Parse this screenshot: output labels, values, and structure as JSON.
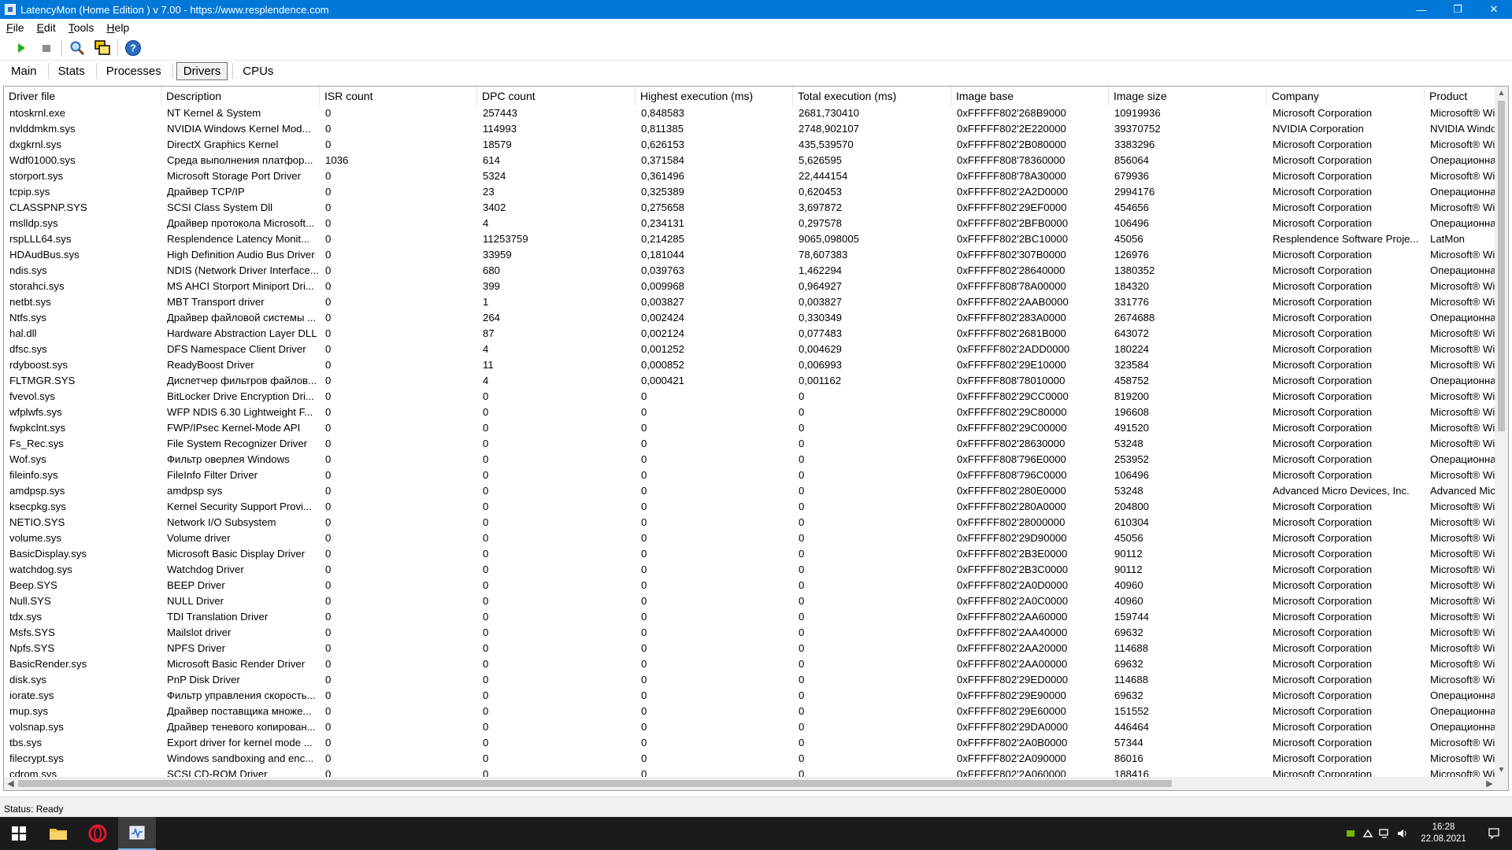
{
  "window": {
    "title": "LatencyMon  (Home Edition )  v 7.00 - https://www.resplendence.com",
    "minimize": "—",
    "maximize": "❐",
    "close": "✕"
  },
  "menu": [
    "File",
    "Edit",
    "Tools",
    "Help"
  ],
  "toolbar": {
    "icons": [
      "play-icon",
      "stop-icon",
      "search-icon",
      "windows-icon",
      "help-icon"
    ]
  },
  "tabs": [
    "Main",
    "Stats",
    "Processes",
    "Drivers",
    "CPUs"
  ],
  "active_tab": "Drivers",
  "table": {
    "headers": [
      "Driver file",
      "Description",
      "ISR count",
      "DPC count",
      "Highest execution (ms)",
      "Total execution (ms)",
      "Image base",
      "Image size",
      "Company",
      "Product"
    ],
    "rows": [
      [
        "ntoskrnl.exe",
        "NT Kernel & System",
        "0",
        "257443",
        "0,848583",
        "2681,730410",
        "0xFFFFF802'268B9000",
        "10919936",
        "Microsoft Corporation",
        "Microsoft® Wi"
      ],
      [
        "nvlddmkm.sys",
        "NVIDIA Windows Kernel Mod...",
        "0",
        "114993",
        "0,811385",
        "2748,902107",
        "0xFFFFF802'2E220000",
        "39370752",
        "NVIDIA Corporation",
        "NVIDIA Windo"
      ],
      [
        "dxgkrnl.sys",
        "DirectX Graphics Kernel",
        "0",
        "18579",
        "0,626153",
        "435,539570",
        "0xFFFFF802'2B080000",
        "3383296",
        "Microsoft Corporation",
        "Microsoft® Wi"
      ],
      [
        "Wdf01000.sys",
        "Среда выполнения платфор...",
        "1036",
        "614",
        "0,371584",
        "5,626595",
        "0xFFFFF808'78360000",
        "856064",
        "Microsoft Corporation",
        "Операционная"
      ],
      [
        "storport.sys",
        "Microsoft Storage Port Driver",
        "0",
        "5324",
        "0,361496",
        "22,444154",
        "0xFFFFF808'78A30000",
        "679936",
        "Microsoft Corporation",
        "Microsoft® Wi"
      ],
      [
        "tcpip.sys",
        "Драйвер TCP/IP",
        "0",
        "23",
        "0,325389",
        "0,620453",
        "0xFFFFF802'2A2D0000",
        "2994176",
        "Microsoft Corporation",
        "Операционная"
      ],
      [
        "CLASSPNP.SYS",
        "SCSI Class System Dll",
        "0",
        "3402",
        "0,275658",
        "3,697872",
        "0xFFFFF802'29EF0000",
        "454656",
        "Microsoft Corporation",
        "Microsoft® Wi"
      ],
      [
        "mslldp.sys",
        "Драйвер протокола Microsoft...",
        "0",
        "4",
        "0,234131",
        "0,297578",
        "0xFFFFF802'2BFB0000",
        "106496",
        "Microsoft Corporation",
        "Операционная"
      ],
      [
        "rspLLL64.sys",
        "Resplendence Latency Monit...",
        "0",
        "11253759",
        "0,214285",
        "9065,098005",
        "0xFFFFF802'2BC10000",
        "45056",
        "Resplendence Software Proje...",
        "LatMon"
      ],
      [
        "HDAudBus.sys",
        "High Definition Audio Bus Driver",
        "0",
        "33959",
        "0,181044",
        "78,607383",
        "0xFFFFF802'307B0000",
        "126976",
        "Microsoft Corporation",
        "Microsoft® Wi"
      ],
      [
        "ndis.sys",
        "NDIS (Network Driver Interface...",
        "0",
        "680",
        "0,039763",
        "1,462294",
        "0xFFFFF802'28640000",
        "1380352",
        "Microsoft Corporation",
        "Операционная"
      ],
      [
        "storahci.sys",
        "MS AHCI Storport Miniport Dri...",
        "0",
        "399",
        "0,009968",
        "0,964927",
        "0xFFFFF808'78A00000",
        "184320",
        "Microsoft Corporation",
        "Microsoft® Wi"
      ],
      [
        "netbt.sys",
        "MBT Transport driver",
        "0",
        "1",
        "0,003827",
        "0,003827",
        "0xFFFFF802'2AAB0000",
        "331776",
        "Microsoft Corporation",
        "Microsoft® Wi"
      ],
      [
        "Ntfs.sys",
        "Драйвер файловой системы ...",
        "0",
        "264",
        "0,002424",
        "0,330349",
        "0xFFFFF802'283A0000",
        "2674688",
        "Microsoft Corporation",
        "Операционная"
      ],
      [
        "hal.dll",
        "Hardware Abstraction Layer DLL",
        "0",
        "87",
        "0,002124",
        "0,077483",
        "0xFFFFF802'2681B000",
        "643072",
        "Microsoft Corporation",
        "Microsoft® Wi"
      ],
      [
        "dfsc.sys",
        "DFS Namespace Client Driver",
        "0",
        "4",
        "0,001252",
        "0,004629",
        "0xFFFFF802'2ADD0000",
        "180224",
        "Microsoft Corporation",
        "Microsoft® Wi"
      ],
      [
        "rdyboost.sys",
        "ReadyBoost Driver",
        "0",
        "11",
        "0,000852",
        "0,006993",
        "0xFFFFF802'29E10000",
        "323584",
        "Microsoft Corporation",
        "Microsoft® Wi"
      ],
      [
        "FLTMGR.SYS",
        "Диспетчер фильтров файлов...",
        "0",
        "4",
        "0,000421",
        "0,001162",
        "0xFFFFF808'78010000",
        "458752",
        "Microsoft Corporation",
        "Операционная"
      ],
      [
        "fvevol.sys",
        "BitLocker Drive Encryption Dri...",
        "0",
        "0",
        "0",
        "0",
        "0xFFFFF802'29CC0000",
        "819200",
        "Microsoft Corporation",
        "Microsoft® Wi"
      ],
      [
        "wfplwfs.sys",
        "WFP NDIS 6.30 Lightweight F...",
        "0",
        "0",
        "0",
        "0",
        "0xFFFFF802'29C80000",
        "196608",
        "Microsoft Corporation",
        "Microsoft® Wi"
      ],
      [
        "fwpkclnt.sys",
        "FWP/IPsec Kernel-Mode API",
        "0",
        "0",
        "0",
        "0",
        "0xFFFFF802'29C00000",
        "491520",
        "Microsoft Corporation",
        "Microsoft® Wi"
      ],
      [
        "Fs_Rec.sys",
        "File System Recognizer Driver",
        "0",
        "0",
        "0",
        "0",
        "0xFFFFF802'28630000",
        "53248",
        "Microsoft Corporation",
        "Microsoft® Wi"
      ],
      [
        "Wof.sys",
        "Фильтр оверлея Windows",
        "0",
        "0",
        "0",
        "0",
        "0xFFFFF808'796E0000",
        "253952",
        "Microsoft Corporation",
        "Операционная"
      ],
      [
        "fileinfo.sys",
        "FileInfo Filter Driver",
        "0",
        "0",
        "0",
        "0",
        "0xFFFFF808'796C0000",
        "106496",
        "Microsoft Corporation",
        "Microsoft® Wi"
      ],
      [
        "amdpsp.sys",
        "amdpsp sys",
        "0",
        "0",
        "0",
        "0",
        "0xFFFFF802'280E0000",
        "53248",
        "Advanced Micro Devices, Inc.",
        "Advanced Micr"
      ],
      [
        "ksecpkg.sys",
        "Kernel Security Support Provi...",
        "0",
        "0",
        "0",
        "0",
        "0xFFFFF802'280A0000",
        "204800",
        "Microsoft Corporation",
        "Microsoft® Wi"
      ],
      [
        "NETIO.SYS",
        "Network I/O Subsystem",
        "0",
        "0",
        "0",
        "0",
        "0xFFFFF802'28000000",
        "610304",
        "Microsoft Corporation",
        "Microsoft® Wi"
      ],
      [
        "volume.sys",
        "Volume driver",
        "0",
        "0",
        "0",
        "0",
        "0xFFFFF802'29D90000",
        "45056",
        "Microsoft Corporation",
        "Microsoft® Wi"
      ],
      [
        "BasicDisplay.sys",
        "Microsoft Basic Display Driver",
        "0",
        "0",
        "0",
        "0",
        "0xFFFFF802'2B3E0000",
        "90112",
        "Microsoft Corporation",
        "Microsoft® Wi"
      ],
      [
        "watchdog.sys",
        "Watchdog Driver",
        "0",
        "0",
        "0",
        "0",
        "0xFFFFF802'2B3C0000",
        "90112",
        "Microsoft Corporation",
        "Microsoft® Wi"
      ],
      [
        "Beep.SYS",
        "BEEP Driver",
        "0",
        "0",
        "0",
        "0",
        "0xFFFFF802'2A0D0000",
        "40960",
        "Microsoft Corporation",
        "Microsoft® Wi"
      ],
      [
        "Null.SYS",
        "NULL Driver",
        "0",
        "0",
        "0",
        "0",
        "0xFFFFF802'2A0C0000",
        "40960",
        "Microsoft Corporation",
        "Microsoft® Wi"
      ],
      [
        "tdx.sys",
        "TDI Translation Driver",
        "0",
        "0",
        "0",
        "0",
        "0xFFFFF802'2AA60000",
        "159744",
        "Microsoft Corporation",
        "Microsoft® Wi"
      ],
      [
        "Msfs.SYS",
        "Mailslot driver",
        "0",
        "0",
        "0",
        "0",
        "0xFFFFF802'2AA40000",
        "69632",
        "Microsoft Corporation",
        "Microsoft® Wi"
      ],
      [
        "Npfs.SYS",
        "NPFS Driver",
        "0",
        "0",
        "0",
        "0",
        "0xFFFFF802'2AA20000",
        "114688",
        "Microsoft Corporation",
        "Microsoft® Wi"
      ],
      [
        "BasicRender.sys",
        "Microsoft Basic Render Driver",
        "0",
        "0",
        "0",
        "0",
        "0xFFFFF802'2AA00000",
        "69632",
        "Microsoft Corporation",
        "Microsoft® Wi"
      ],
      [
        "disk.sys",
        "PnP Disk Driver",
        "0",
        "0",
        "0",
        "0",
        "0xFFFFF802'29ED0000",
        "114688",
        "Microsoft Corporation",
        "Microsoft® Wi"
      ],
      [
        "iorate.sys",
        "Фильтр управления скорость...",
        "0",
        "0",
        "0",
        "0",
        "0xFFFFF802'29E90000",
        "69632",
        "Microsoft Corporation",
        "Операционная"
      ],
      [
        "mup.sys",
        "Драйвер поставщика множе...",
        "0",
        "0",
        "0",
        "0",
        "0xFFFFF802'29E60000",
        "151552",
        "Microsoft Corporation",
        "Операционная"
      ],
      [
        "volsnap.sys",
        "Драйвер теневого копирован...",
        "0",
        "0",
        "0",
        "0",
        "0xFFFFF802'29DA0000",
        "446464",
        "Microsoft Corporation",
        "Операционная"
      ],
      [
        "tbs.sys",
        "Export driver for kernel mode ...",
        "0",
        "0",
        "0",
        "0",
        "0xFFFFF802'2A0B0000",
        "57344",
        "Microsoft Corporation",
        "Microsoft® Wi"
      ],
      [
        "filecrypt.sys",
        "Windows sandboxing and enc...",
        "0",
        "0",
        "0",
        "0",
        "0xFFFFF802'2A090000",
        "86016",
        "Microsoft Corporation",
        "Microsoft® Wi"
      ],
      [
        "cdrom.sys",
        "SCSI CD-ROM Driver",
        "0",
        "0",
        "0",
        "0",
        "0xFFFFF802'2A060000",
        "188416",
        "Microsoft Corporation",
        "Microsoft® Wi"
      ]
    ]
  },
  "status": "Status: Ready",
  "taskbar": {
    "time": "16:28",
    "date": "22.08.2021"
  },
  "colors": {
    "titlebar": "#0078d7",
    "taskbar": "#1b1b1b"
  }
}
